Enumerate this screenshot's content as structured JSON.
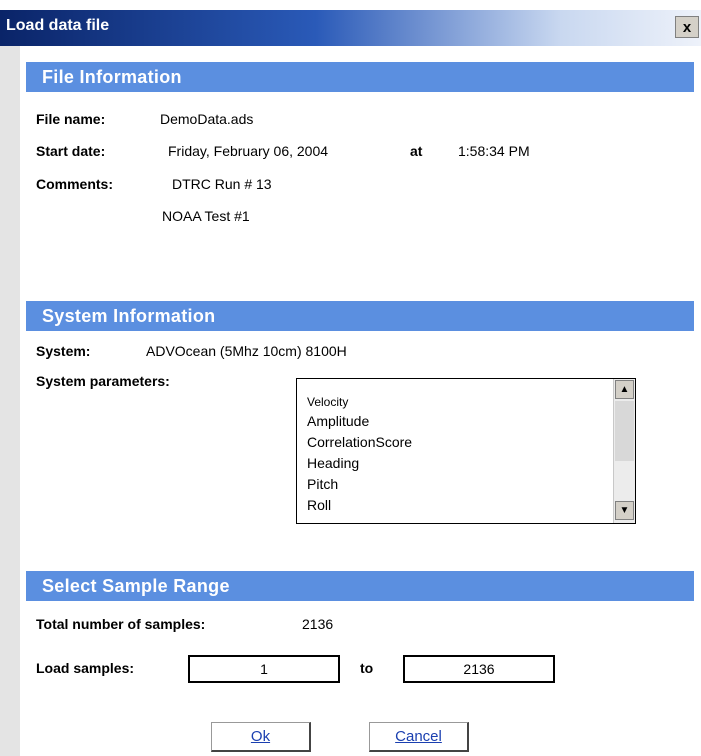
{
  "window": {
    "title": "Load data file",
    "close_glyph": "x"
  },
  "file_info": {
    "header": "File Information",
    "file_name_label": "File name:",
    "file_name": "DemoData.ads",
    "start_date_label": "Start date:",
    "start_date": "Friday, February 06, 2004",
    "at_label": "at",
    "start_time": "1:58:34 PM",
    "comments_label": "Comments:",
    "comment_line1": "DTRC Run # 13",
    "comment_line2": "NOAA Test #1"
  },
  "system_info": {
    "header": "System Information",
    "system_label": "System:",
    "system_value": "ADVOcean (5Mhz 10cm) 8100H",
    "params_label": "System parameters:",
    "params": [
      "Velocity",
      "Amplitude",
      "CorrelationScore",
      "Heading",
      "Pitch",
      "Roll"
    ]
  },
  "sample_range": {
    "header": "Select Sample Range",
    "total_label": "Total number of samples:",
    "total_value": "2136",
    "load_label": "Load samples:",
    "from_value": "1",
    "to_label": "to",
    "to_value": "2136"
  },
  "buttons": {
    "ok": "Ok",
    "cancel": "Cancel"
  },
  "icons": {
    "scroll_up": "scroll-up-icon",
    "scroll_down": "scroll-down-icon"
  }
}
